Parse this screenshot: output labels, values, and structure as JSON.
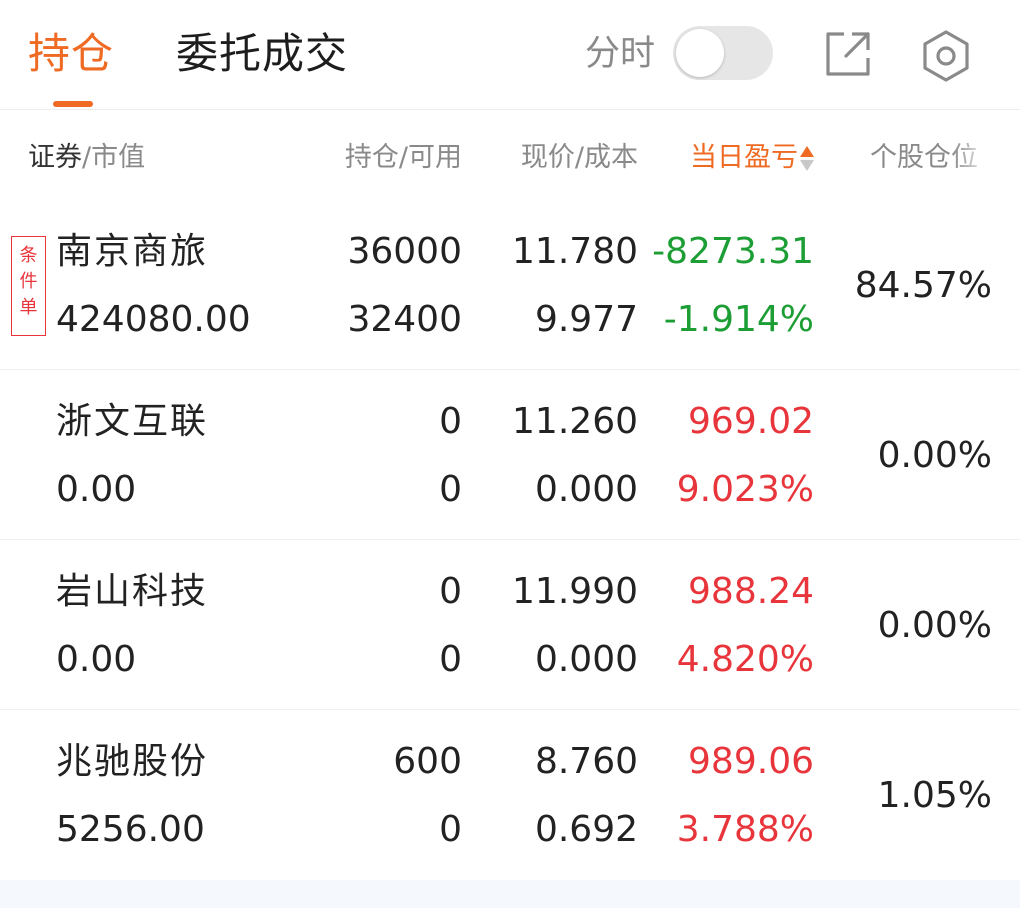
{
  "header": {
    "tabs": [
      {
        "label": "持仓",
        "active": true
      },
      {
        "label": "委托成交",
        "active": false
      }
    ],
    "timeshare_label": "分时",
    "timeshare_toggle_on": false,
    "icons": [
      "share-icon",
      "gear-icon"
    ]
  },
  "columns": {
    "security_primary": "证券",
    "security_secondary": "/市值",
    "position": "持仓/可用",
    "price": "现价/成本",
    "daily_pnl": "当日盈亏",
    "weight": "个股仓位"
  },
  "badge": {
    "line1": "条",
    "line2": "件",
    "line3": "单"
  },
  "holdings": [
    {
      "name": "南京商旅",
      "market_value": "424080.00",
      "quantity": "36000",
      "available": "32400",
      "price": "11.780",
      "cost": "9.977",
      "daily_pnl": "-8273.31",
      "daily_pnl_pct": "-1.914%",
      "weight": "84.57%",
      "has_condition_order": true
    },
    {
      "name": "浙文互联",
      "market_value": "0.00",
      "quantity": "0",
      "available": "0",
      "price": "11.260",
      "cost": "0.000",
      "daily_pnl": "969.02",
      "daily_pnl_pct": "9.023%",
      "weight": "0.00%"
    },
    {
      "name": "岩山科技",
      "market_value": "0.00",
      "quantity": "0",
      "available": "0",
      "price": "11.990",
      "cost": "0.000",
      "daily_pnl": "988.24",
      "daily_pnl_pct": "4.820%",
      "weight": "0.00%"
    },
    {
      "name": "兆驰股份",
      "market_value": "5256.00",
      "quantity": "600",
      "available": "0",
      "price": "8.760",
      "cost": "0.692",
      "daily_pnl": "989.06",
      "daily_pnl_pct": "3.788%",
      "weight": "1.05%"
    }
  ],
  "colors": {
    "accent": "#ef6a22",
    "loss": "#1d9e35",
    "gain": "#e8353b",
    "muted": "#8a8a8a"
  }
}
